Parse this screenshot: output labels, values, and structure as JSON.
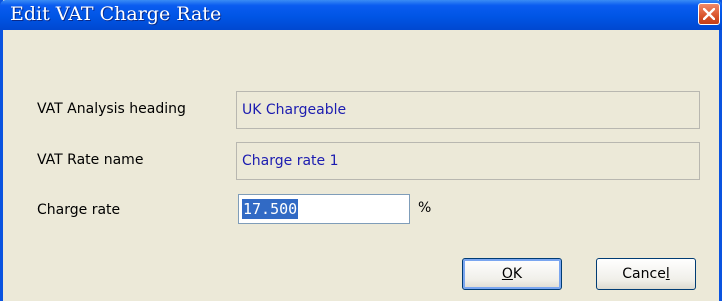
{
  "window": {
    "title": "Edit VAT Charge Rate"
  },
  "fields": {
    "vat_analysis_heading": {
      "label": "VAT Analysis heading",
      "value": "UK Chargeable"
    },
    "vat_rate_name": {
      "label": "VAT Rate name",
      "value": "Charge rate 1"
    },
    "charge_rate": {
      "label": "Charge rate",
      "value": "17.500",
      "unit": "%"
    }
  },
  "buttons": {
    "ok": {
      "mnemonic": "O",
      "rest": "K"
    },
    "cancel": {
      "before": "Cance",
      "mnemonic": "l"
    }
  },
  "icons": {
    "close": "close-icon"
  },
  "colors": {
    "titlebar": "#0055e5",
    "close": "#d9542b",
    "readonly_text": "#1c1cb0",
    "selection": "#316ac5"
  }
}
